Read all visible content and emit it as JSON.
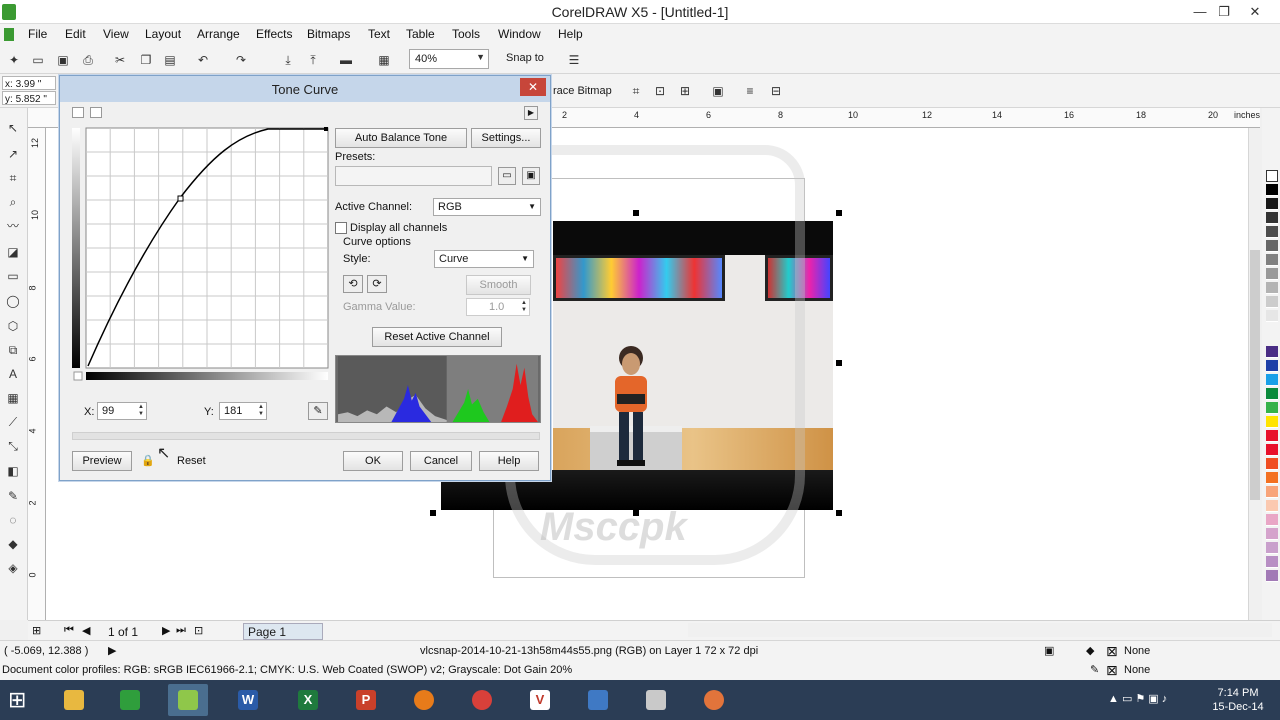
{
  "window": {
    "title": "CorelDRAW X5 - [Untitled-1]",
    "min": "—",
    "max": "❐",
    "close": "✕"
  },
  "menu": [
    "File",
    "Edit",
    "View",
    "Layout",
    "Arrange",
    "Effects",
    "Bitmaps",
    "Text",
    "Table",
    "Tools",
    "Window",
    "Help"
  ],
  "toolbar": {
    "zoom": "40%",
    "snap_to": "Snap to"
  },
  "propbar": {
    "x": "3.99 \"",
    "y": "5.852 \"",
    "x_label": "x:",
    "y_label": "y:",
    "trace_bitmap": "race Bitmap"
  },
  "ruler": {
    "h_labels": [
      "2",
      "4",
      "6",
      "8",
      "10",
      "12",
      "14",
      "16",
      "18",
      "20"
    ],
    "units": "inches",
    "v_labels": [
      "12",
      "10",
      "8",
      "6",
      "4",
      "2",
      "0"
    ]
  },
  "dialog": {
    "title": "Tone Curve",
    "auto_balance": "Auto Balance Tone",
    "settings": "Settings...",
    "presets_label": "Presets:",
    "active_channel_label": "Active Channel:",
    "active_channel": "RGB",
    "display_all": "Display all channels",
    "curve_options": "Curve options",
    "style_label": "Style:",
    "style": "Curve",
    "smooth": "Smooth",
    "gamma_label": "Gamma Value:",
    "gamma_value": "1.0",
    "reset_channel": "Reset Active Channel",
    "x_label": "X:",
    "x_value": "99",
    "y_label": "Y:",
    "y_value": "181",
    "preview": "Preview",
    "reset": "Reset",
    "ok": "OK",
    "cancel": "Cancel",
    "help": "Help"
  },
  "pagenav": {
    "pages": "1 of 1",
    "tab": "Page 1"
  },
  "status": {
    "coords": "( -5.069, 12.388 )",
    "object": "vlcsnap-2014-10-21-13h58m44s55.png (RGB) on Layer 1 72 x 72 dpi",
    "profiles": "Document color profiles: RGB: sRGB IEC61966-2.1; CMYK: U.S. Web Coated (SWOP) v2; Grayscale: Dot Gain 20%",
    "fill": "None",
    "outline": "None"
  },
  "taskbar": {
    "time": "7:14 PM",
    "date": "15-Dec-14"
  },
  "watermark": "Msccpk",
  "colors": {
    "accent": "#c5d6ea",
    "close": "#c7463a",
    "taskbar": "#2b3d55"
  }
}
